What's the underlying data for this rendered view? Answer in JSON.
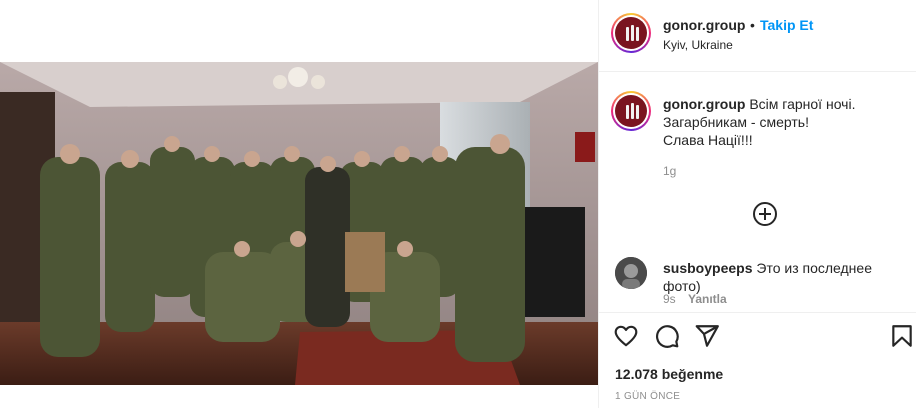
{
  "post": {
    "username": "gonor.group",
    "separator": "•",
    "follow_label": "Takip Et",
    "location": "Kyiv, Ukraine"
  },
  "caption": {
    "username": "gonor.group",
    "line1": "Всім гарної ночі.",
    "line2": "Загарбникам - смерть!",
    "line3": "Слава Нації!!!",
    "time": "1g"
  },
  "comment": {
    "username": "susboypeeps",
    "text": "Это из последнее фото)",
    "time": "9s",
    "reply_label": "Yanıtla"
  },
  "actions": {
    "like_icon": "heart-icon",
    "comment_icon": "comment-icon",
    "share_icon": "share-icon",
    "save_icon": "bookmark-icon"
  },
  "stats": {
    "likes": "12.078 beğenme",
    "posted": "1 GÜN ÖNCE"
  },
  "colors": {
    "link_blue": "#0095f6",
    "text": "#262626",
    "muted": "#8e8e8e",
    "brand_avatar": "#7a1420"
  }
}
